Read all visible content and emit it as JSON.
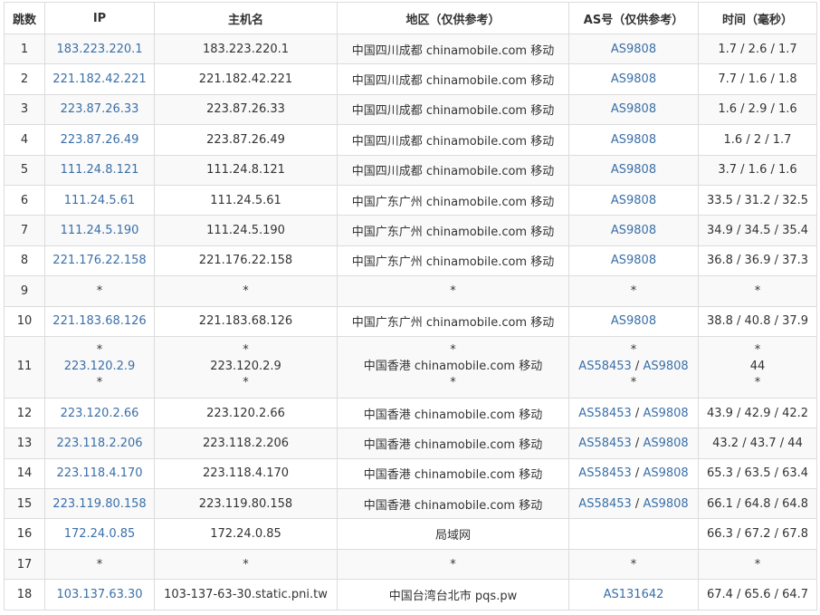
{
  "headers": [
    "跳数",
    "IP",
    "主机名",
    "地区（仅供参考）",
    "AS号（仅供参考）",
    "时间（毫秒）"
  ],
  "rows": [
    {
      "hop": "1",
      "ip": [
        "183.223.220.1"
      ],
      "host": [
        "183.223.220.1"
      ],
      "region": [
        "中国四川成都 chinamobile.com 移动"
      ],
      "as": [
        [
          "AS9808"
        ]
      ],
      "time": [
        "1.7 / 2.6 / 1.7"
      ]
    },
    {
      "hop": "2",
      "ip": [
        "221.182.42.221"
      ],
      "host": [
        "221.182.42.221"
      ],
      "region": [
        "中国四川成都 chinamobile.com 移动"
      ],
      "as": [
        [
          "AS9808"
        ]
      ],
      "time": [
        "7.7 / 1.6 / 1.8"
      ]
    },
    {
      "hop": "3",
      "ip": [
        "223.87.26.33"
      ],
      "host": [
        "223.87.26.33"
      ],
      "region": [
        "中国四川成都 chinamobile.com 移动"
      ],
      "as": [
        [
          "AS9808"
        ]
      ],
      "time": [
        "1.6 / 2.9 / 1.6"
      ]
    },
    {
      "hop": "4",
      "ip": [
        "223.87.26.49"
      ],
      "host": [
        "223.87.26.49"
      ],
      "region": [
        "中国四川成都 chinamobile.com 移动"
      ],
      "as": [
        [
          "AS9808"
        ]
      ],
      "time": [
        "1.6 / 2 / 1.7"
      ]
    },
    {
      "hop": "5",
      "ip": [
        "111.24.8.121"
      ],
      "host": [
        "111.24.8.121"
      ],
      "region": [
        "中国四川成都 chinamobile.com 移动"
      ],
      "as": [
        [
          "AS9808"
        ]
      ],
      "time": [
        "3.7 / 1.6 / 1.6"
      ]
    },
    {
      "hop": "6",
      "ip": [
        "111.24.5.61"
      ],
      "host": [
        "111.24.5.61"
      ],
      "region": [
        "中国广东广州 chinamobile.com 移动"
      ],
      "as": [
        [
          "AS9808"
        ]
      ],
      "time": [
        "33.5 / 31.2 / 32.5"
      ]
    },
    {
      "hop": "7",
      "ip": [
        "111.24.5.190"
      ],
      "host": [
        "111.24.5.190"
      ],
      "region": [
        "中国广东广州 chinamobile.com 移动"
      ],
      "as": [
        [
          "AS9808"
        ]
      ],
      "time": [
        "34.9 / 34.5 / 35.4"
      ]
    },
    {
      "hop": "8",
      "ip": [
        "221.176.22.158"
      ],
      "host": [
        "221.176.22.158"
      ],
      "region": [
        "中国广东广州 chinamobile.com 移动"
      ],
      "as": [
        [
          "AS9808"
        ]
      ],
      "time": [
        "36.8 / 36.9 / 37.3"
      ]
    },
    {
      "hop": "9",
      "ip": [
        "*"
      ],
      "host": [
        "*"
      ],
      "region": [
        "*"
      ],
      "as": [
        [
          "*"
        ]
      ],
      "time": [
        "*"
      ]
    },
    {
      "hop": "10",
      "ip": [
        "221.183.68.126"
      ],
      "host": [
        "221.183.68.126"
      ],
      "region": [
        "中国广东广州 chinamobile.com 移动"
      ],
      "as": [
        [
          "AS9808"
        ]
      ],
      "time": [
        "38.8 / 40.8 / 37.9"
      ]
    },
    {
      "hop": "11",
      "ip": [
        "*",
        "223.120.2.9",
        "*"
      ],
      "host": [
        "*",
        "223.120.2.9",
        "*"
      ],
      "region": [
        "*",
        "中国香港 chinamobile.com 移动",
        "*"
      ],
      "as": [
        [
          "*"
        ],
        [
          "AS58453",
          "AS9808"
        ],
        [
          "*"
        ]
      ],
      "time": [
        "*",
        "44",
        "*"
      ]
    },
    {
      "hop": "12",
      "ip": [
        "223.120.2.66"
      ],
      "host": [
        "223.120.2.66"
      ],
      "region": [
        "中国香港 chinamobile.com 移动"
      ],
      "as": [
        [
          "AS58453",
          "AS9808"
        ]
      ],
      "time": [
        "43.9 / 42.9 / 42.2"
      ]
    },
    {
      "hop": "13",
      "ip": [
        "223.118.2.206"
      ],
      "host": [
        "223.118.2.206"
      ],
      "region": [
        "中国香港 chinamobile.com 移动"
      ],
      "as": [
        [
          "AS58453",
          "AS9808"
        ]
      ],
      "time": [
        "43.2 / 43.7 / 44"
      ]
    },
    {
      "hop": "14",
      "ip": [
        "223.118.4.170"
      ],
      "host": [
        "223.118.4.170"
      ],
      "region": [
        "中国香港 chinamobile.com 移动"
      ],
      "as": [
        [
          "AS58453",
          "AS9808"
        ]
      ],
      "time": [
        "65.3 / 63.5 / 63.4"
      ]
    },
    {
      "hop": "15",
      "ip": [
        "223.119.80.158"
      ],
      "host": [
        "223.119.80.158"
      ],
      "region": [
        "中国香港 chinamobile.com 移动"
      ],
      "as": [
        [
          "AS58453",
          "AS9808"
        ]
      ],
      "time": [
        "66.1 / 64.8 / 64.8"
      ]
    },
    {
      "hop": "16",
      "ip": [
        "172.24.0.85"
      ],
      "host": [
        "172.24.0.85"
      ],
      "region": [
        "局域网"
      ],
      "as": [
        []
      ],
      "time": [
        "66.3 / 67.2 / 67.8"
      ]
    },
    {
      "hop": "17",
      "ip": [
        "*"
      ],
      "host": [
        "*"
      ],
      "region": [
        "*"
      ],
      "as": [
        [
          "*"
        ]
      ],
      "time": [
        "*"
      ]
    },
    {
      "hop": "18",
      "ip": [
        "103.137.63.30"
      ],
      "host": [
        "103-137-63-30.static.pni.tw"
      ],
      "region": [
        "中国台湾台北市 pqs.pw"
      ],
      "as": [
        [
          "AS131642"
        ]
      ],
      "time": [
        "67.4 / 65.6 / 64.7"
      ]
    }
  ],
  "as_separator": " / ",
  "colors": {
    "link": "#3a6fa8",
    "border": "#dcdcdc",
    "stripe": "#f9f9f9"
  }
}
